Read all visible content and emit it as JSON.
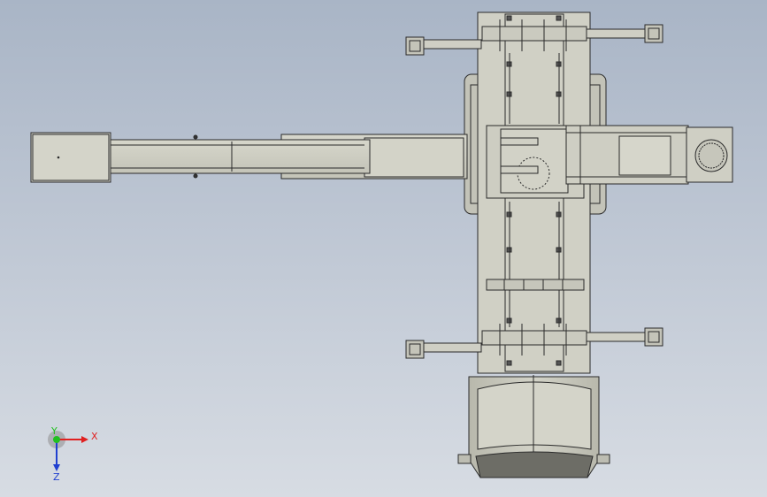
{
  "viewport": {
    "background_top": "#a9b5c6",
    "background_bottom": "#d7dce3",
    "part_fill": "#cfcfc4",
    "part_fill_dark": "#b9b9ae",
    "edge_color": "#2a2a2a"
  },
  "model": {
    "parts": [
      "crane-base",
      "telescopic-boom",
      "turntable",
      "outrigger-top-left",
      "outrigger-top-right",
      "outrigger-bottom-left",
      "outrigger-bottom-right",
      "cab",
      "counterweight",
      "winch-drum"
    ]
  },
  "triad": {
    "x_label": "X",
    "y_label": "Y",
    "z_label": "Z",
    "x_color": "#e02020",
    "y_color": "#20c020",
    "z_color": "#2040d0"
  }
}
